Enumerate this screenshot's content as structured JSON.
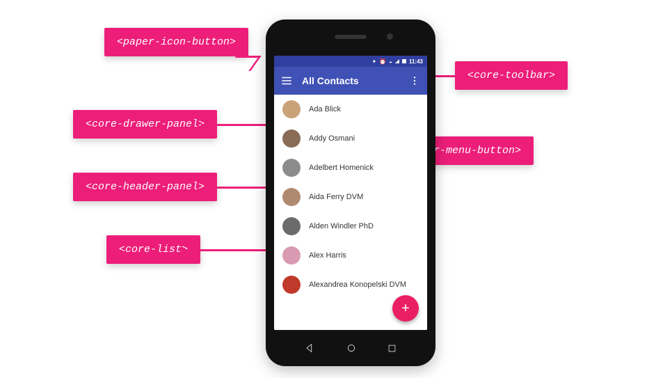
{
  "statusbar": {
    "time": "11:43"
  },
  "toolbar": {
    "title": "All Contacts"
  },
  "fab": {
    "glyph": "+"
  },
  "contacts": [
    {
      "name": "Ada Blick",
      "avatar_color": "#caa27a"
    },
    {
      "name": "Addy Osmani",
      "avatar_color": "#8a6b55"
    },
    {
      "name": "Adelbert Homenick",
      "avatar_color": "#8c8c8c"
    },
    {
      "name": "Aida Ferry DVM",
      "avatar_color": "#b08a70"
    },
    {
      "name": "Alden Windler PhD",
      "avatar_color": "#6b6b6b"
    },
    {
      "name": "Alex Harris",
      "avatar_color": "#d89ab0"
    },
    {
      "name": "Alexandrea Konopelski DVM",
      "avatar_color": "#c0392b"
    }
  ],
  "callouts": {
    "paper_icon_button": "<paper-icon-button>",
    "core_toolbar": "<core-toolbar>",
    "core_drawer_panel": "<core-drawer-panel>",
    "paper_menu_button": "<paper-menu-button>",
    "core_header_panel": "<core-header-panel>",
    "core_list": "<core-list>"
  }
}
